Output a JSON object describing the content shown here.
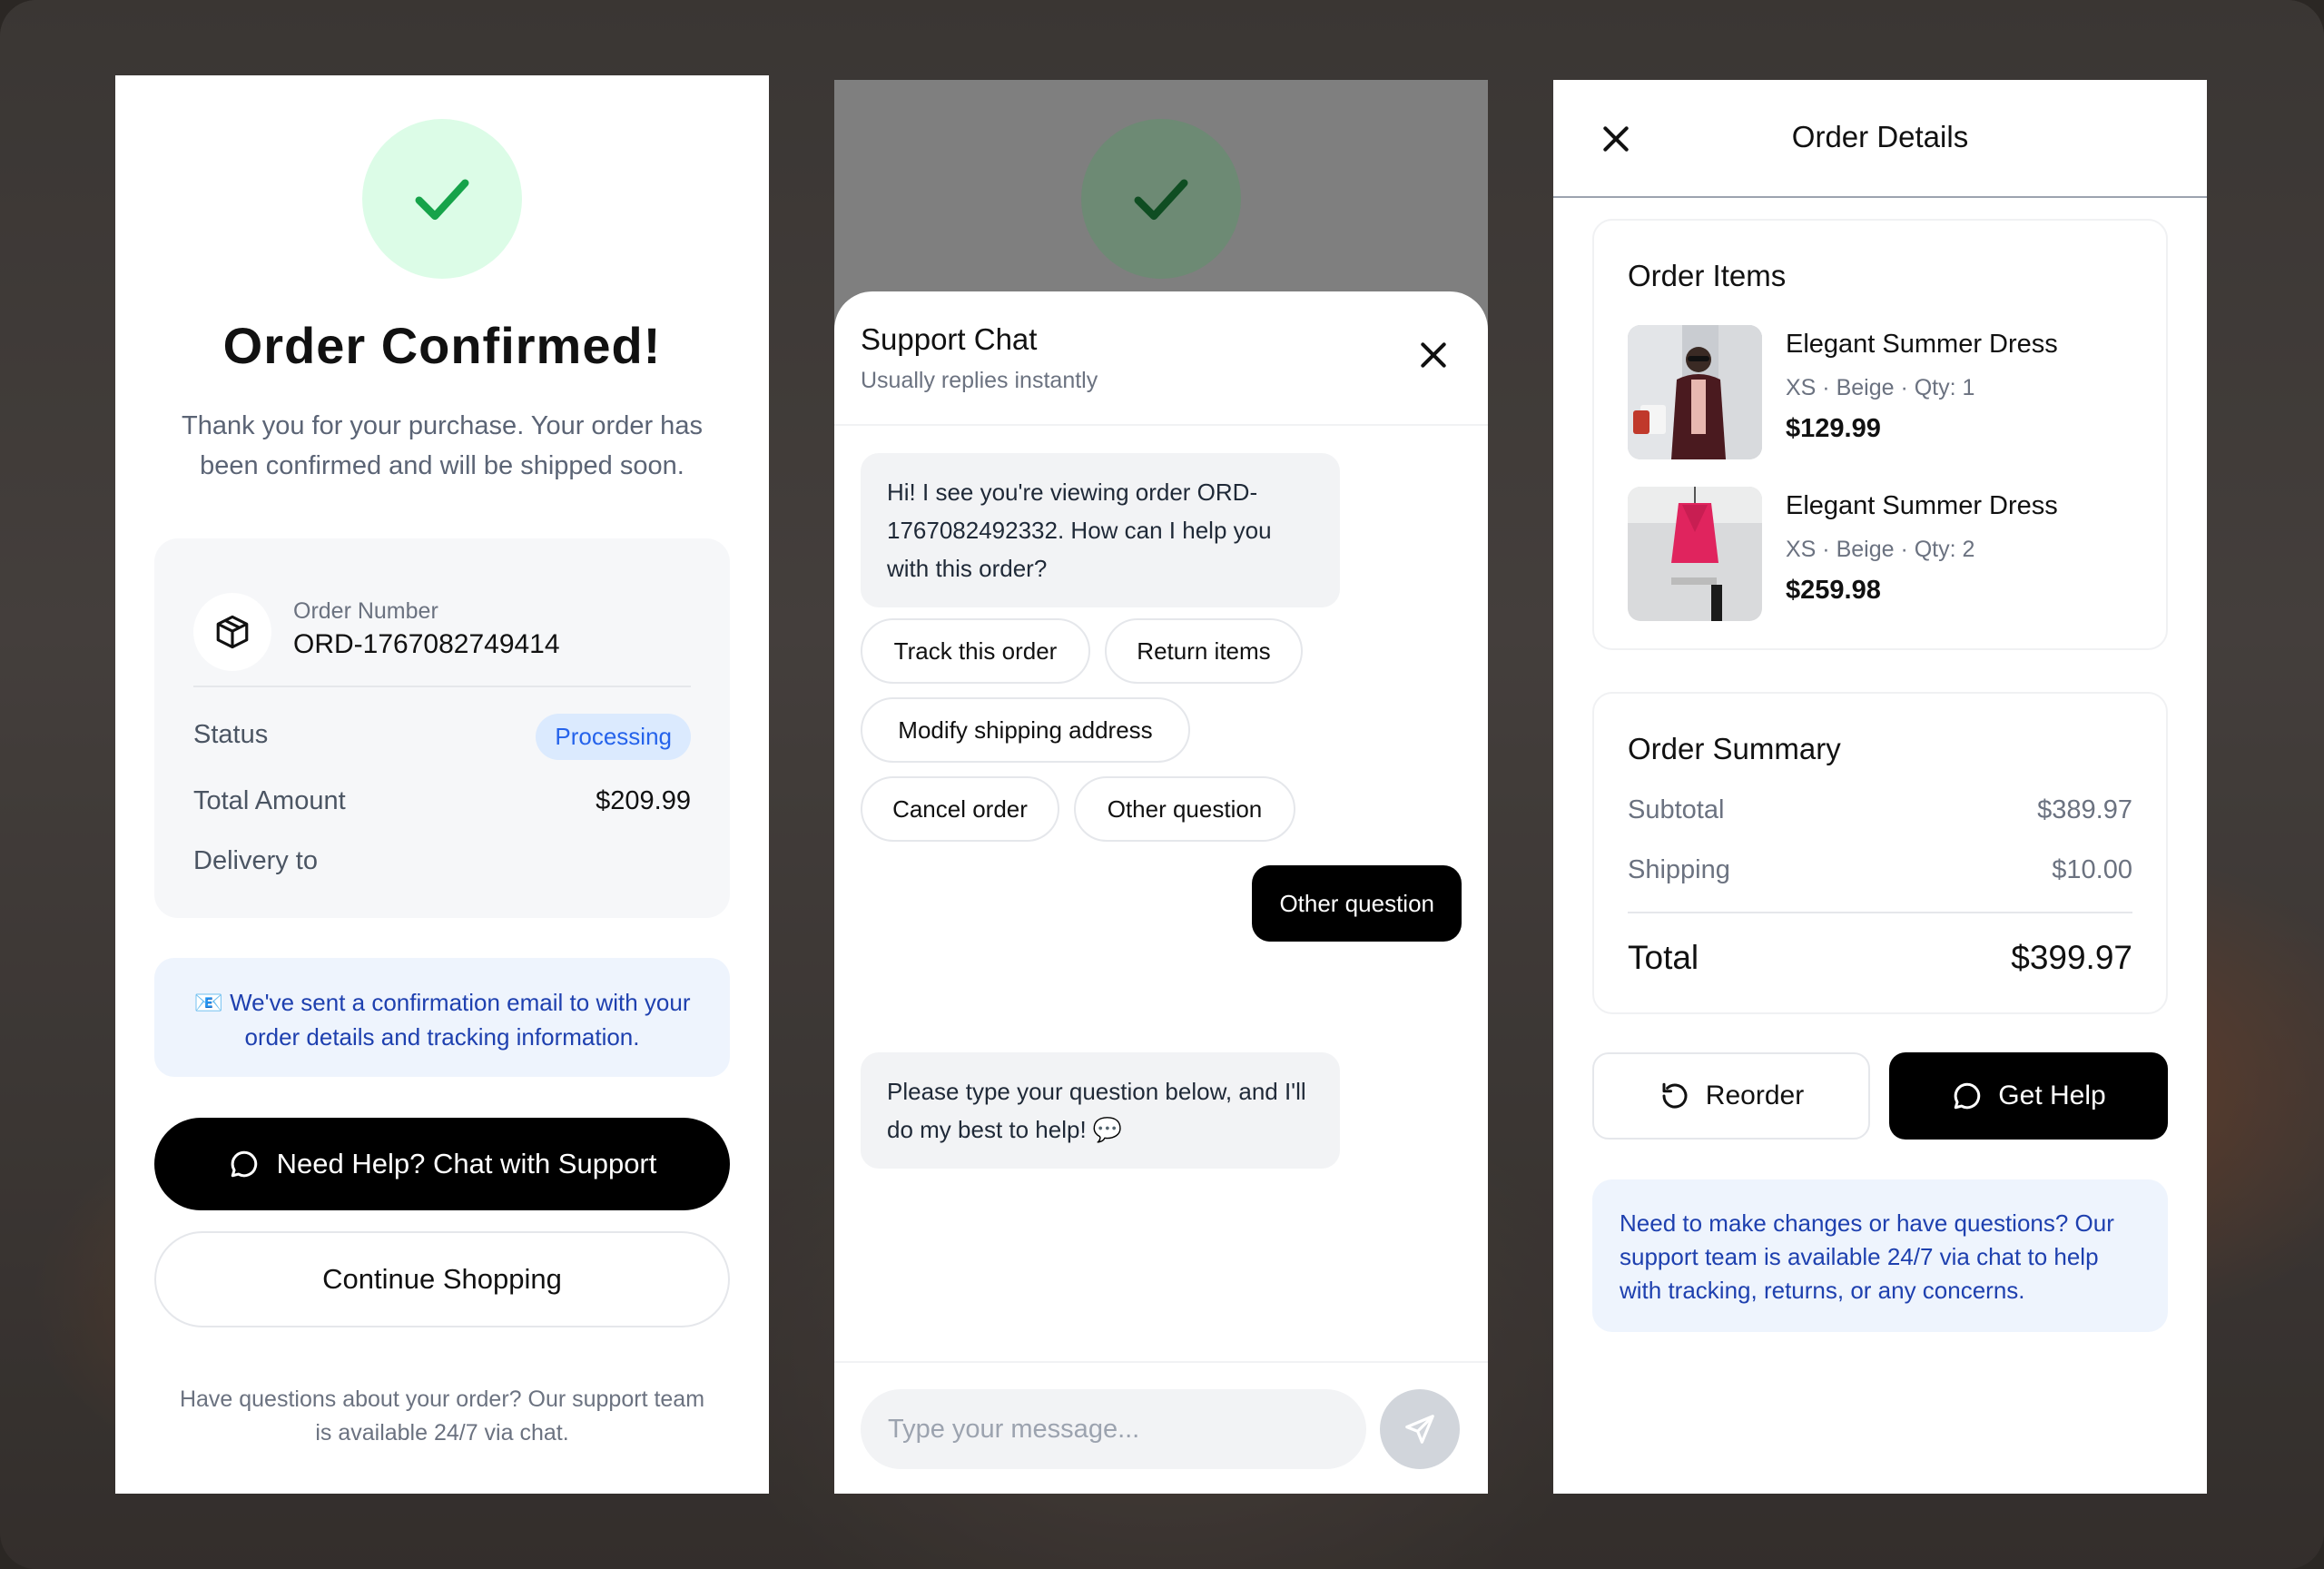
{
  "confirmation": {
    "title": "Order Confirmed!",
    "subtitle": "Thank you for your purchase. Your order has been confirmed and will be shipped soon.",
    "order_number_label": "Order Number",
    "order_number": "ORD-1767082749414",
    "status_label": "Status",
    "status_value": "Processing",
    "total_label": "Total Amount",
    "total_value": "$209.99",
    "delivery_label": "Delivery to",
    "email_note": "📧 We've sent a confirmation email to with your order details and tracking information.",
    "help_button": "Need Help? Chat with Support",
    "continue_button": "Continue Shopping",
    "footer": "Have questions about your order? Our support team is available 24/7 via chat."
  },
  "chat": {
    "title": "Support Chat",
    "subtitle": "Usually replies instantly",
    "bot_greeting": "Hi! I see you're viewing order ORD-1767082492332. How can I help you with this order?",
    "quick_replies": [
      "Track this order",
      "Return items",
      "Modify shipping address",
      "Cancel order",
      "Other question"
    ],
    "user_message": "Other question",
    "bot_reply": "Please type your question below, and I'll do my best to help! 💬",
    "input_placeholder": "Type your message..."
  },
  "details": {
    "title": "Order Details",
    "items_title": "Order Items",
    "items": [
      {
        "name": "Elegant Summer Dress",
        "meta": "XS · Beige · Qty: 1",
        "price": "$129.99"
      },
      {
        "name": "Elegant Summer Dress",
        "meta": "XS · Beige · Qty: 2",
        "price": "$259.98"
      }
    ],
    "summary_title": "Order Summary",
    "subtotal_label": "Subtotal",
    "subtotal_value": "$389.97",
    "shipping_label": "Shipping",
    "shipping_value": "$10.00",
    "total_label": "Total",
    "total_value": "$399.97",
    "reorder_button": "Reorder",
    "gethelp_button": "Get Help",
    "help_note": "Need to make changes or have questions? Our support team is available 24/7 via chat to help with tracking, returns, or any concerns."
  },
  "colors": {
    "success_green": "#16a34a",
    "badge_blue": "#2563eb",
    "note_blue": "#1e40af",
    "primary_black": "#000000"
  },
  "icons": [
    "check-icon",
    "package-icon",
    "chat-bubble-icon",
    "close-icon",
    "send-icon",
    "refresh-icon"
  ]
}
